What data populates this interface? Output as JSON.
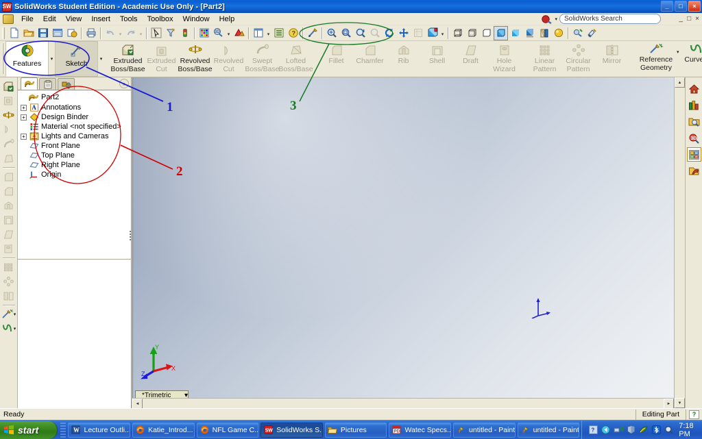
{
  "window": {
    "title": "SolidWorks Student Edition - Academic Use Only - [Part2]",
    "app_icon": "solidworks-icon",
    "minimize": "_",
    "maximize": "□",
    "close": "×",
    "doc_minimize": "_",
    "doc_restore": "□",
    "doc_close": "×"
  },
  "menu": {
    "items": [
      {
        "label": "File"
      },
      {
        "label": "Edit"
      },
      {
        "label": "View"
      },
      {
        "label": "Insert"
      },
      {
        "label": "Tools"
      },
      {
        "label": "Toolbox"
      },
      {
        "label": "Window"
      },
      {
        "label": "Help"
      }
    ]
  },
  "search": {
    "value": "SolidWorks Search",
    "icon": "solidworks-search-icon",
    "caret": "▾"
  },
  "toolbar": {
    "groups": [
      {
        "buttons": [
          {
            "name": "new-document-icon"
          },
          {
            "name": "open-document-icon"
          },
          {
            "name": "save-icon"
          },
          {
            "name": "print-preview-icon"
          },
          {
            "name": "make-drawing-icon"
          }
        ]
      },
      {
        "buttons": [
          {
            "name": "print-icon"
          }
        ]
      },
      {
        "buttons": [
          {
            "name": "undo-icon",
            "dim": true
          },
          {
            "name": "redo-icon",
            "dim": true
          }
        ]
      },
      {
        "buttons": [
          {
            "name": "select-arrow-icon"
          },
          {
            "name": "filter-icon"
          },
          {
            "name": "rebuild-icon"
          }
        ]
      },
      {
        "buttons": [
          {
            "name": "options-icon"
          },
          {
            "name": "edit-appearance-icon"
          },
          {
            "name": "apply-scene-icon"
          }
        ]
      },
      {
        "buttons": [
          {
            "name": "view-layout-icon"
          },
          {
            "name": "display-pane-icon"
          },
          {
            "name": "help-icon"
          }
        ]
      },
      {
        "buttons": [
          {
            "name": "sketch-icon"
          }
        ]
      },
      {
        "buttons": [
          {
            "name": "zoom-to-fit-icon"
          },
          {
            "name": "zoom-to-area-icon"
          },
          {
            "name": "zoom-in-out-icon"
          },
          {
            "name": "zoom-to-selection-icon",
            "dim": true
          },
          {
            "name": "rotate-view-icon"
          },
          {
            "name": "pan-icon"
          },
          {
            "name": "3d-drawing-view-icon",
            "dim": true
          },
          {
            "name": "view-orientation-icon"
          }
        ]
      },
      {
        "buttons": [
          {
            "name": "wireframe-icon"
          },
          {
            "name": "hidden-lines-visible-icon"
          },
          {
            "name": "hidden-lines-removed-icon"
          },
          {
            "name": "shaded-with-edges-icon"
          },
          {
            "name": "shaded-icon"
          },
          {
            "name": "shadows-in-shaded-mode-icon"
          },
          {
            "name": "section-view-icon"
          },
          {
            "name": "realview-graphics-icon"
          }
        ]
      },
      {
        "buttons": [
          {
            "name": "edit-appearance-2-icon"
          },
          {
            "name": "edit-material-icon"
          }
        ]
      }
    ]
  },
  "command_manager": {
    "tabs": [
      {
        "label": "Features",
        "icon": "features-icon",
        "active": true
      },
      {
        "label": "Sketch",
        "icon": "sketch-pencil-icon",
        "active": false
      }
    ],
    "buttons": [
      {
        "label": "Extruded\nBoss/Base",
        "l1": "Extruded",
        "l2": "Boss/Base",
        "icon": "extruded-boss-icon",
        "enabled": true
      },
      {
        "label": "Extruded Cut",
        "l1": "Extruded",
        "l2": "Cut",
        "icon": "extruded-cut-icon",
        "enabled": false
      },
      {
        "label": "Revolved Boss/Base",
        "l1": "Revolved",
        "l2": "Boss/Base",
        "icon": "revolved-boss-icon",
        "enabled": true
      },
      {
        "label": "Revolved Cut",
        "l1": "Revolved",
        "l2": "Cut",
        "icon": "revolved-cut-icon",
        "enabled": false
      },
      {
        "label": "Swept Boss/Base",
        "l1": "Swept",
        "l2": "Boss/Base",
        "icon": "swept-boss-icon",
        "enabled": false
      },
      {
        "label": "Lofted Boss/Base",
        "l1": "Lofted",
        "l2": "Boss/Base",
        "icon": "lofted-boss-icon",
        "enabled": false
      },
      {
        "label": "Fillet",
        "l1": "Fillet",
        "l2": "",
        "icon": "fillet-icon",
        "enabled": false
      },
      {
        "label": "Chamfer",
        "l1": "Chamfer",
        "l2": "",
        "icon": "chamfer-icon",
        "enabled": false
      },
      {
        "label": "Rib",
        "l1": "Rib",
        "l2": "",
        "icon": "rib-icon",
        "enabled": false
      },
      {
        "label": "Shell",
        "l1": "Shell",
        "l2": "",
        "icon": "shell-icon",
        "enabled": false
      },
      {
        "label": "Draft",
        "l1": "Draft",
        "l2": "",
        "icon": "draft-icon",
        "enabled": false
      },
      {
        "label": "Hole Wizard",
        "l1": "Hole",
        "l2": "Wizard",
        "icon": "hole-wizard-icon",
        "enabled": false
      },
      {
        "label": "Linear Pattern",
        "l1": "Linear",
        "l2": "Pattern",
        "icon": "linear-pattern-icon",
        "enabled": false
      },
      {
        "label": "Circular Pattern",
        "l1": "Circular",
        "l2": "Pattern",
        "icon": "circular-pattern-icon",
        "enabled": false
      },
      {
        "label": "Mirror",
        "l1": "Mirror",
        "l2": "",
        "icon": "mirror-icon",
        "enabled": false
      },
      {
        "label": "Reference Geometry",
        "l1": "Reference",
        "l2": "Geometry",
        "icon": "reference-geometry-icon",
        "enabled": true,
        "caret": true
      },
      {
        "label": "Curves",
        "l1": "Curves",
        "l2": "",
        "icon": "curves-icon",
        "enabled": true,
        "caret": true
      }
    ]
  },
  "feature_manager": {
    "tabs": [
      {
        "name": "feature-manager-tab",
        "selected": true
      },
      {
        "name": "property-manager-tab",
        "selected": false
      },
      {
        "name": "configuration-manager-tab",
        "selected": false
      }
    ],
    "pin": "»",
    "tree": [
      {
        "label": "Part2",
        "icon": "part-icon",
        "expandable": false,
        "indent": 0,
        "root": true
      },
      {
        "label": "Annotations",
        "icon": "annotations-icon",
        "expandable": true,
        "indent": 1
      },
      {
        "label": "Design Binder",
        "icon": "design-binder-icon",
        "expandable": true,
        "indent": 1
      },
      {
        "label": "Material <not specified>",
        "icon": "material-icon",
        "expandable": false,
        "indent": 1
      },
      {
        "label": "Lights and Cameras",
        "icon": "lights-cameras-icon",
        "expandable": true,
        "indent": 1
      },
      {
        "label": "Front Plane",
        "icon": "plane-icon",
        "expandable": false,
        "indent": 1
      },
      {
        "label": "Top Plane",
        "icon": "plane-icon",
        "expandable": false,
        "indent": 1
      },
      {
        "label": "Right Plane",
        "icon": "plane-icon",
        "expandable": false,
        "indent": 1
      },
      {
        "label": "Origin",
        "icon": "origin-icon",
        "expandable": false,
        "indent": 1
      }
    ]
  },
  "left_toolbar": {
    "buttons": [
      {
        "name": "extruded-boss-icon",
        "dim": false
      },
      {
        "name": "extruded-cut-icon",
        "dim": true
      },
      {
        "name": "revolved-boss-icon",
        "dim": false
      },
      {
        "name": "revolved-cut-icon",
        "dim": true
      },
      {
        "name": "swept-boss-icon",
        "dim": true
      },
      {
        "name": "lofted-boss-icon",
        "dim": true
      },
      {
        "name": "fillet-icon",
        "dim": true
      },
      {
        "name": "chamfer-icon",
        "dim": true
      },
      {
        "name": "rib-icon",
        "dim": true
      },
      {
        "name": "shell-icon",
        "dim": true
      },
      {
        "name": "draft-icon",
        "dim": true
      },
      {
        "name": "hole-wizard-icon",
        "dim": true
      },
      {
        "name": "linear-pattern-icon",
        "dim": true
      },
      {
        "name": "circular-pattern-icon",
        "dim": true
      },
      {
        "name": "mirror-icon",
        "dim": true
      },
      {
        "name": "reference-geometry-icon",
        "dim": false
      },
      {
        "name": "curves-icon",
        "dim": false
      }
    ]
  },
  "graphics": {
    "view_orientation": "*Trimetric",
    "view_caret": "▾",
    "triad": {
      "x": "X",
      "y": "Y",
      "z": "Z"
    },
    "origin_marker": "origin-triad-marker"
  },
  "task_pane": {
    "buttons": [
      {
        "name": "solidworks-resources-icon",
        "selected": false
      },
      {
        "name": "design-library-icon",
        "selected": false
      },
      {
        "name": "file-explorer-icon",
        "selected": false
      },
      {
        "name": "search-3d-contentcentral-icon",
        "selected": false
      },
      {
        "name": "view-palette-icon",
        "selected": true
      },
      {
        "name": "appearances-scenes-icon",
        "selected": false
      }
    ]
  },
  "status_bar": {
    "message": "Ready",
    "mode": "Editing Part",
    "indicator": "?"
  },
  "taskbar": {
    "start_label": "start",
    "start_icon": "windows-flag-icon",
    "items": [
      {
        "label": "Lecture Outli...",
        "icon": "word-doc-icon",
        "active": false
      },
      {
        "label": "Katie_Introd...",
        "icon": "firefox-icon",
        "active": false
      },
      {
        "label": "NFL Game C...",
        "icon": "firefox-icon",
        "active": false
      },
      {
        "label": "SolidWorks S...",
        "icon": "solidworks-icon",
        "active": true
      },
      {
        "label": "Pictures",
        "icon": "folder-icon",
        "active": false
      },
      {
        "label": "Watec Specs...",
        "icon": "pdf-icon",
        "active": false
      },
      {
        "label": "untitled - Paint",
        "icon": "paint-icon",
        "active": false
      },
      {
        "label": "untitled - Paint",
        "icon": "paint-icon",
        "active": false
      }
    ],
    "tray": [
      {
        "name": "help-tray-icon"
      },
      {
        "name": "back-arrow-tray-icon"
      },
      {
        "name": "network-tray-icon"
      },
      {
        "name": "shield-tray-icon"
      },
      {
        "name": "antivirus-tray-icon"
      },
      {
        "name": "bluetooth-tray-icon"
      },
      {
        "name": "search-tray-icon"
      }
    ],
    "clock": "7:18 PM"
  },
  "annotations": [
    {
      "number": "1",
      "color": "#1a1ad0",
      "target": "feature-manager-expand-arrow"
    },
    {
      "number": "2",
      "color": "#d00000",
      "target": "feature-manager-tree"
    },
    {
      "number": "3",
      "color": "#157a25",
      "target": "view-zoom-toolbar"
    }
  ]
}
